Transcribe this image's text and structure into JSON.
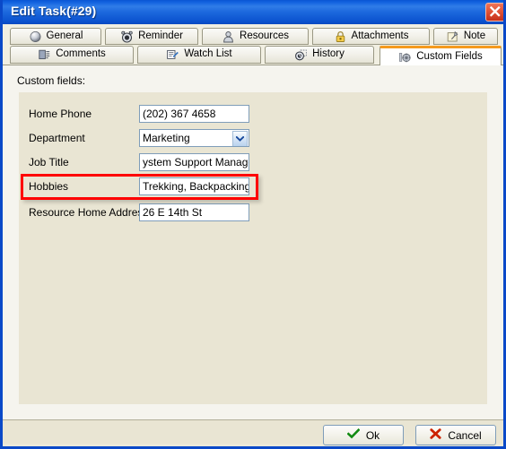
{
  "window": {
    "title": "Edit Task(#29)",
    "close_icon": "close-icon",
    "titlebar_color": "#1c68dd",
    "accent_color": "#f59a1e",
    "highlight_color": "#ff0000"
  },
  "tabs_row1": [
    {
      "label": "General",
      "icon": "sphere-icon"
    },
    {
      "label": "Reminder",
      "icon": "alarm-clock-icon"
    },
    {
      "label": "Resources",
      "icon": "person-icon"
    },
    {
      "label": "Attachments",
      "icon": "padlock-icon"
    },
    {
      "label": "Note",
      "icon": "pushpin-note-icon"
    }
  ],
  "tabs_row2": [
    {
      "label": "Comments",
      "icon": "comment-lines-icon",
      "active": false
    },
    {
      "label": "Watch List",
      "icon": "watch-list-icon",
      "active": false
    },
    {
      "label": "History",
      "icon": "history-clock-icon",
      "active": false
    },
    {
      "label": "Custom Fields",
      "icon": "gear-icon",
      "active": true
    }
  ],
  "page": {
    "section_label": "Custom fields:",
    "fields": [
      {
        "label": "Home Phone",
        "value": "(202) 367 4658",
        "type": "text",
        "highlighted": false
      },
      {
        "label": "Department",
        "value": "Marketing",
        "type": "combobox",
        "highlighted": false
      },
      {
        "label": "Job Title",
        "value": "ystem Support Manager",
        "type": "text",
        "highlighted": false
      },
      {
        "label": "Hobbies",
        "value": "Trekking, Backpacking,",
        "type": "text",
        "highlighted": true
      },
      {
        "label": "Resource Home Address",
        "value": "26 E 14th St",
        "type": "text",
        "highlighted": false
      }
    ]
  },
  "footer": {
    "ok_label": "Ok",
    "ok_icon": "green-check-icon",
    "cancel_label": "Cancel",
    "cancel_icon": "red-x-icon"
  }
}
